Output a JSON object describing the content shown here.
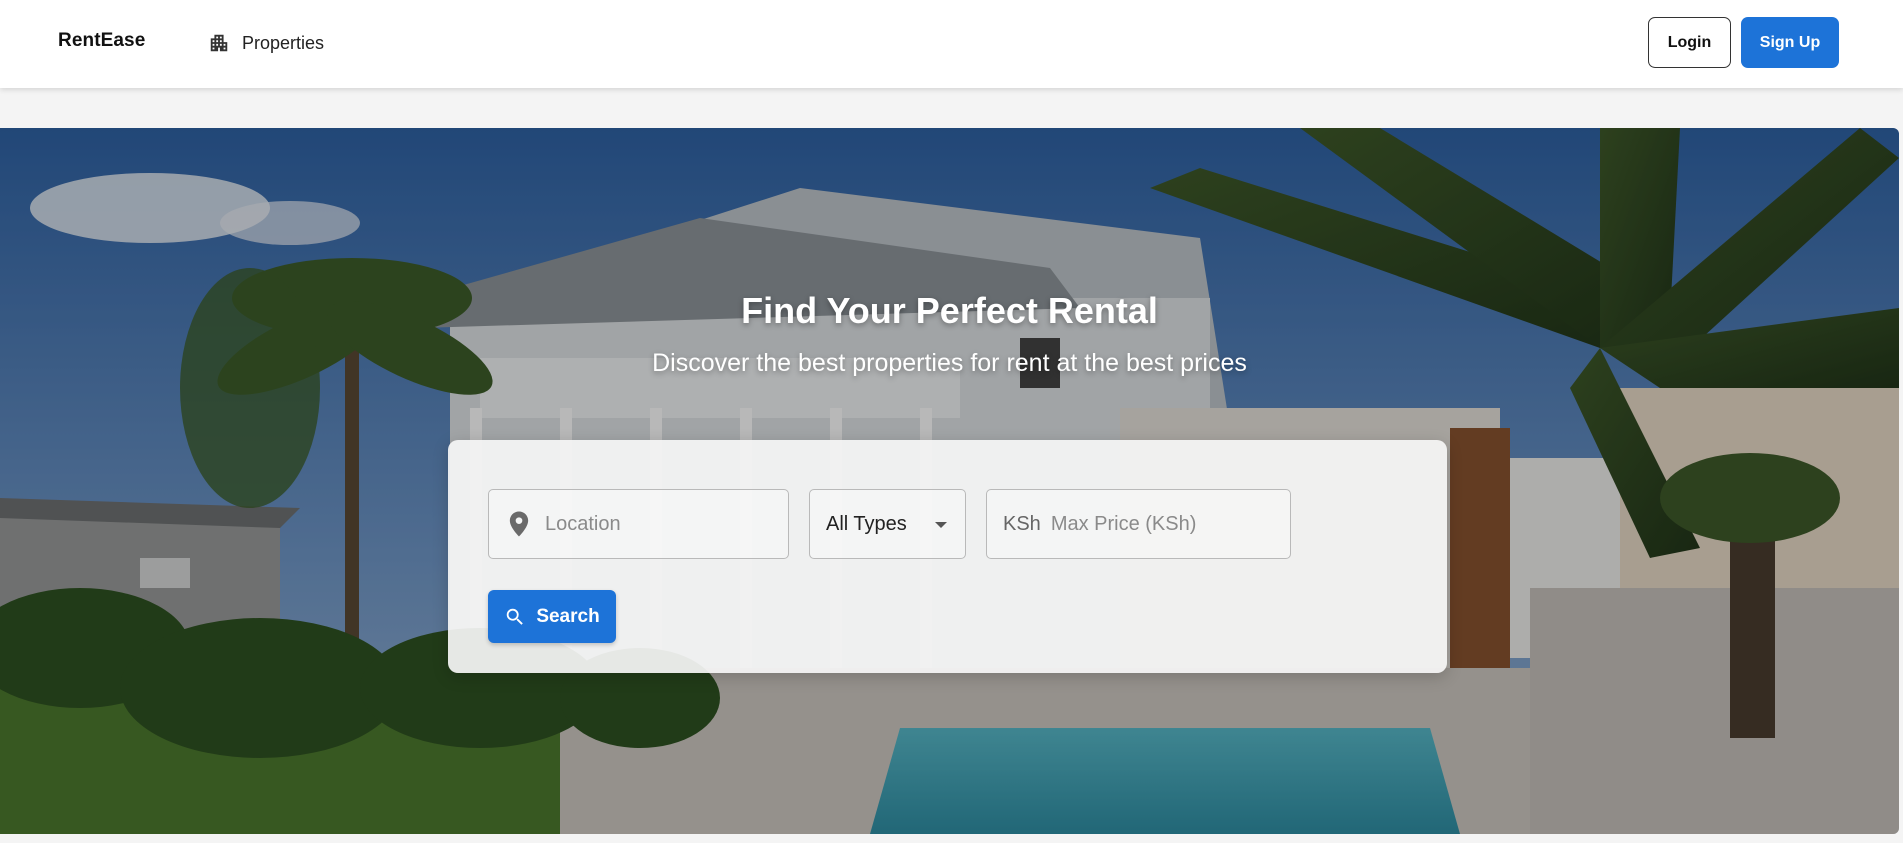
{
  "header": {
    "brand": "RentEase",
    "nav": [
      {
        "label": "Properties",
        "icon": "building-icon"
      }
    ],
    "login_label": "Login",
    "signup_label": "Sign Up"
  },
  "hero": {
    "title": "Find Your Perfect Rental",
    "subtitle": "Discover the best properties for rent at the best prices",
    "background_image": "house-with-pool-and-palm-trees"
  },
  "search": {
    "location_placeholder": "Location",
    "type_selected": "All Types",
    "price_prefix": "KSh",
    "price_placeholder": "Max Price (KSh)",
    "button_label": "Search"
  },
  "colors": {
    "primary": "#1d73d8",
    "page_background": "#f4f4f4",
    "header_background": "#ffffff"
  }
}
